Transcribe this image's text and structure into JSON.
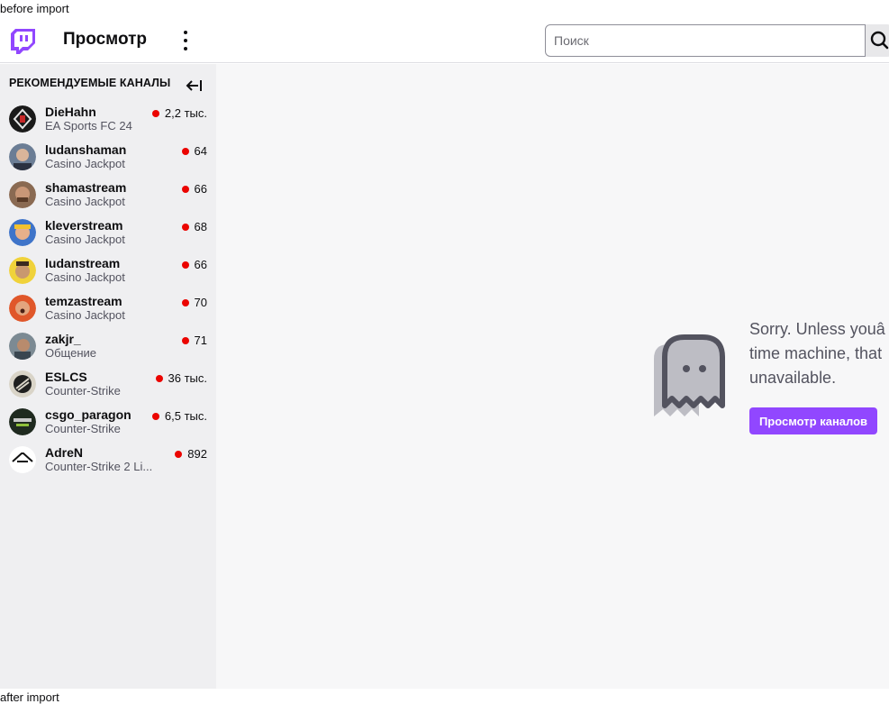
{
  "markers": {
    "top": "before import",
    "bottom": "after import"
  },
  "header": {
    "title": "Просмотр",
    "search_placeholder": "Поиск",
    "logo_icon": "twitch-logo",
    "more_icon": "more-vertical-icon",
    "search_icon": "search-icon"
  },
  "sidebar": {
    "title": "РЕКОМЕНДУЕМЫЕ КАНАЛЫ",
    "collapse_icon": "collapse-arrow-icon",
    "channels": [
      {
        "name": "DieHahn",
        "game": "EA Sports FC 24",
        "viewers": "2,2 тыс."
      },
      {
        "name": "ludanshaman",
        "game": "Casino Jackpot",
        "viewers": "64"
      },
      {
        "name": "shamastream",
        "game": "Casino Jackpot",
        "viewers": "66"
      },
      {
        "name": "kleverstream",
        "game": "Casino Jackpot",
        "viewers": "68"
      },
      {
        "name": "ludanstream",
        "game": "Casino Jackpot",
        "viewers": "66"
      },
      {
        "name": "temzastream",
        "game": "Casino Jackpot",
        "viewers": "70"
      },
      {
        "name": "zakjr_",
        "game": "Общение",
        "viewers": "71"
      },
      {
        "name": "ESLCS",
        "game": "Counter-Strike",
        "viewers": "36 тыс."
      },
      {
        "name": "csgo_paragon",
        "game": "Counter-Strike",
        "viewers": "6,5 тыс."
      },
      {
        "name": "AdreN",
        "game": "Counter-Strike 2 Li...",
        "viewers": "892"
      }
    ]
  },
  "main": {
    "message": "Sorry. Unless youâ\ntime machine, that\nunavailable.",
    "browse_button": "Просмотр каналов",
    "ghost_icon": "ghost-icon"
  },
  "colors": {
    "accent": "#9147ff",
    "live": "#eb0400",
    "sidebar_bg": "#efeff1",
    "main_bg": "#f7f7f8"
  }
}
